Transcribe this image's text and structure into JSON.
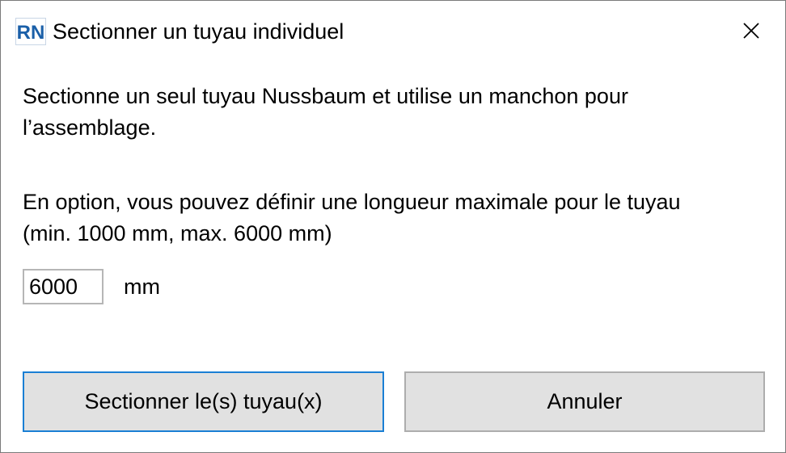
{
  "window": {
    "title": "Sectionner un tuyau individuel",
    "logo_text": "RN",
    "logo_color": "#1a5fa8",
    "close_icon": "close-icon"
  },
  "content": {
    "paragraph1_line1": "Sectionne un seul tuyau Nussbaum et utilise un manchon pour",
    "paragraph1_line2": "l’assemblage.",
    "paragraph2_line1": "En option, vous pouvez définir une longueur maximale pour le tuyau",
    "paragraph2_line2": "(min. 1000 mm, max. 6000 mm)"
  },
  "length": {
    "value": "6000",
    "unit": "mm"
  },
  "buttons": {
    "confirm_label": "Sectionner le(s) tuyau(x)",
    "cancel_label": "Annuler"
  },
  "colors": {
    "accent": "#1a7fd4",
    "button_bg": "#e1e1e1"
  }
}
